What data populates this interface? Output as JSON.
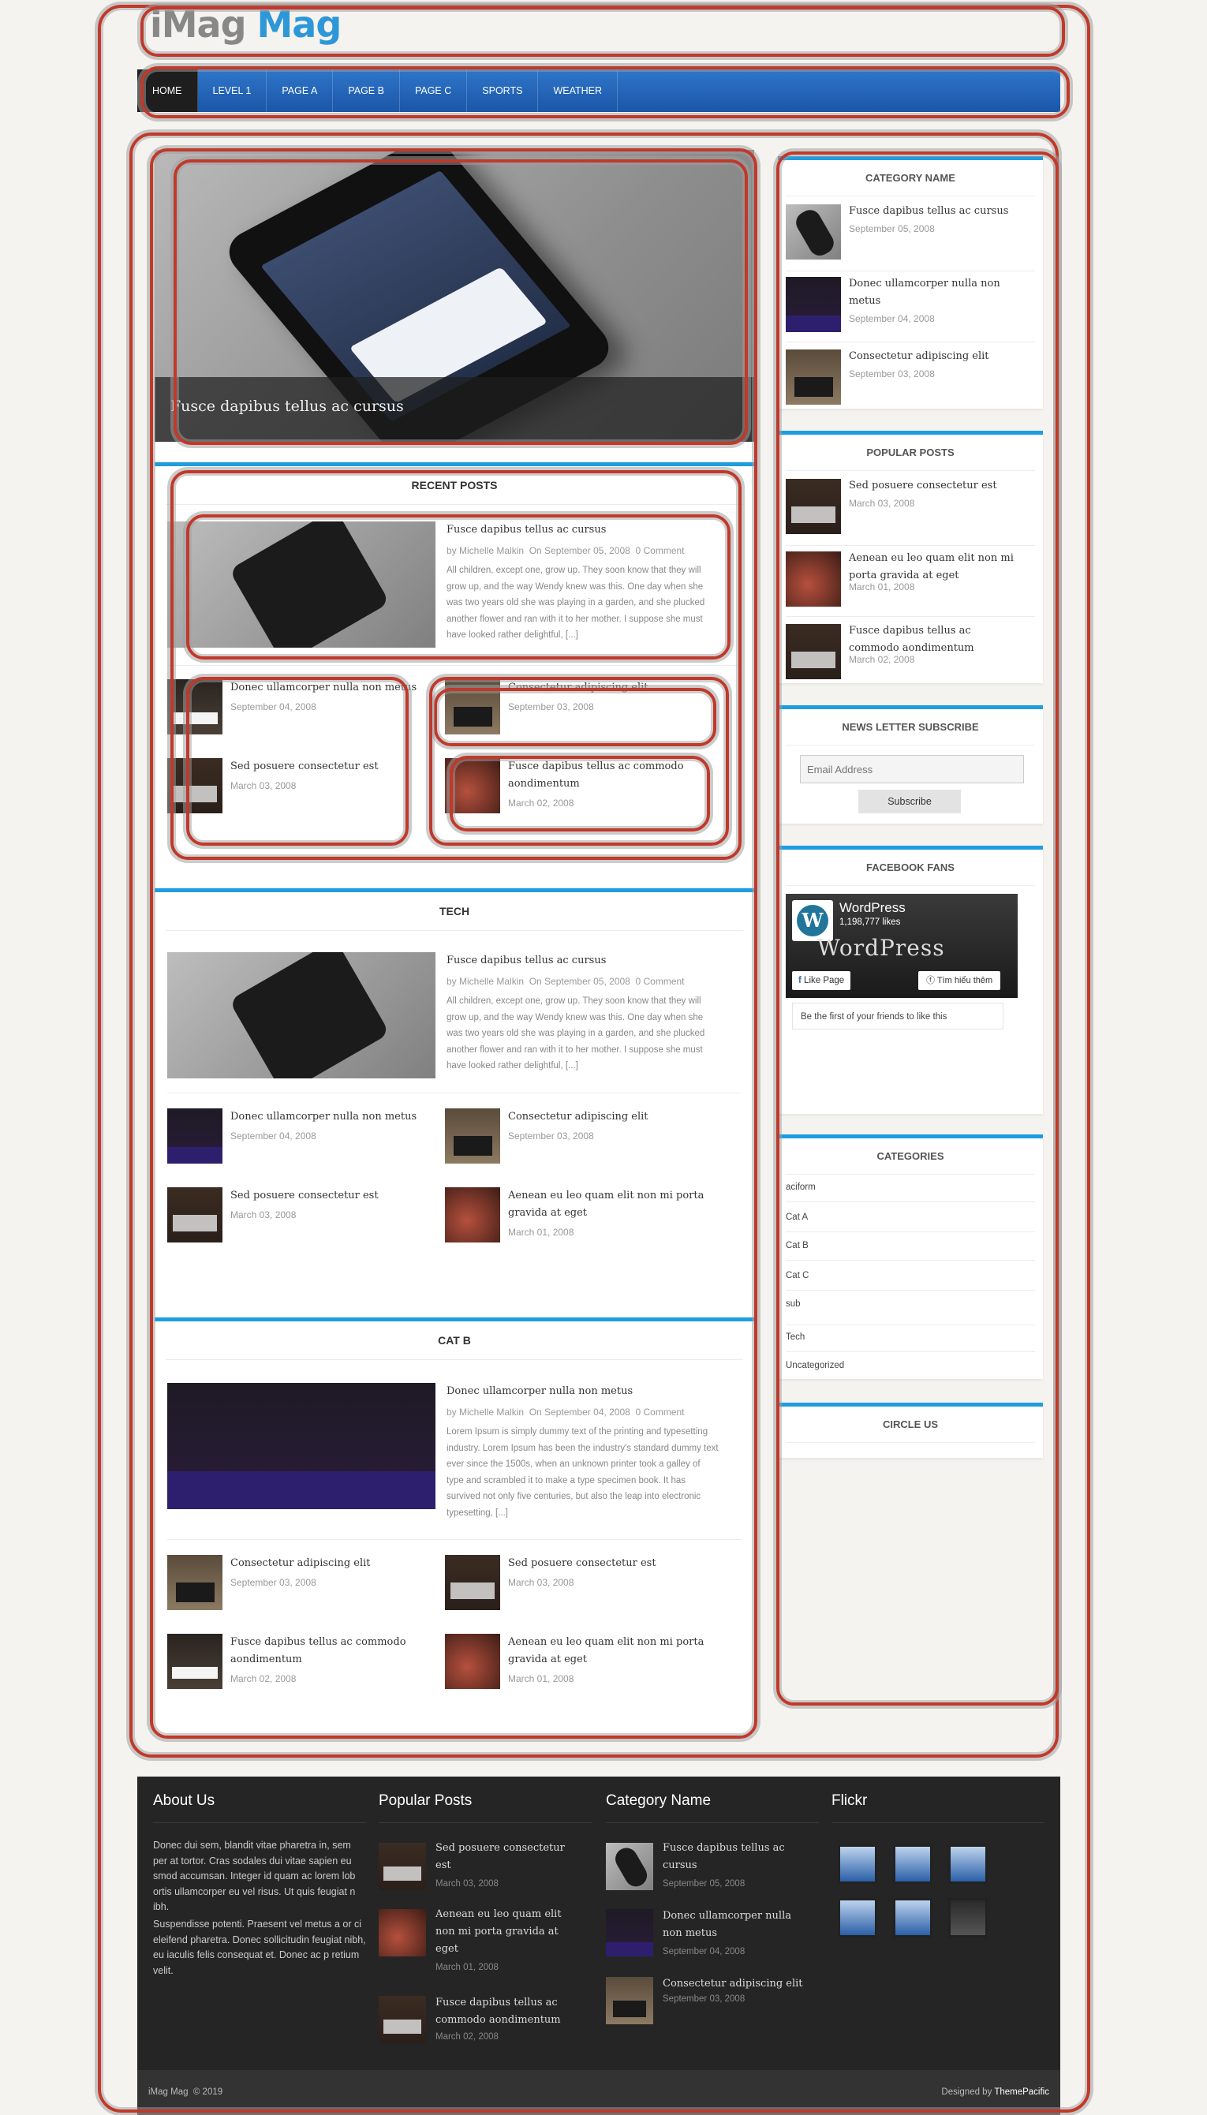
{
  "site": {
    "logo_part1": "iMag",
    "logo_part2": "Mag"
  },
  "nav": [
    "HOME",
    "LEVEL 1",
    "PAGE A",
    "PAGE B",
    "PAGE C",
    "SPORTS",
    "WEATHER"
  ],
  "slider": {
    "caption": "Fusce dapibus tellus ac cursus"
  },
  "recent": {
    "heading": "RECENT POSTS",
    "featured": {
      "title": "Fusce dapibus tellus ac cursus",
      "by": "by Michelle Malkin",
      "on": "On September 05, 2008",
      "comments": "0 Comment",
      "excerpt": "All children, except one, grow up. They soon know that they will grow up, and the way Wendy knew was this. One day when she was two years old she was playing in a garden, and she plucked another flower and ran with it to her mother. I suppose she must have looked rather delightful, [...]"
    },
    "items": [
      {
        "title": "Donec ullamcorper nulla non metus",
        "date": "September 04, 2008"
      },
      {
        "title": "Consectetur adipiscing elit",
        "date": "September 03, 2008"
      },
      {
        "title": "Sed posuere consectetur est",
        "date": "March 03, 2008"
      },
      {
        "title": "Fusce dapibus tellus ac commodo aondimentum",
        "date": "March 02, 2008"
      }
    ]
  },
  "tech": {
    "heading": "TECH",
    "featured": {
      "title": "Fusce dapibus tellus ac cursus",
      "by": "by Michelle Malkin",
      "on": "On September 05, 2008",
      "comments": "0 Comment",
      "excerpt": "All children, except one, grow up. They soon know that they will grow up, and the way Wendy knew was this. One day when she was two years old she was playing in a garden, and she plucked another flower and ran with it to her mother. I suppose she must have looked rather delightful, [...]"
    },
    "items": [
      {
        "title": "Donec ullamcorper nulla non metus",
        "date": "September 04, 2008"
      },
      {
        "title": "Consectetur adipiscing elit",
        "date": "September 03, 2008"
      },
      {
        "title": "Sed posuere consectetur est",
        "date": "March 03, 2008"
      },
      {
        "title": "Aenean eu leo quam elit non mi porta gravida at eget",
        "date": "March 01, 2008"
      }
    ]
  },
  "catb": {
    "heading": "CAT B",
    "featured": {
      "title": "Donec ullamcorper nulla non metus",
      "by": "by Michelle Malkin",
      "on": "On September 04, 2008",
      "comments": "0 Comment",
      "excerpt": "Lorem Ipsum is simply dummy text of the printing and typesetting industry. Lorem Ipsum has been the industry's standard dummy text ever since the 1500s, when an unknown printer took a galley of type and scrambled it to make a type specimen book. It has survived not only five centuries, but also the leap into electronic typesetting, [...]"
    },
    "items": [
      {
        "title": "Consectetur adipiscing elit",
        "date": "September 03, 2008"
      },
      {
        "title": "Sed posuere consectetur est",
        "date": "March 03, 2008"
      },
      {
        "title": "Fusce dapibus tellus ac commodo aondimentum",
        "date": "March 02, 2008"
      },
      {
        "title": "Aenean eu leo quam elit non mi porta gravida at eget",
        "date": "March 01, 2008"
      }
    ]
  },
  "sidebar": {
    "category_name": {
      "heading": "CATEGORY NAME",
      "items": [
        {
          "title": "Fusce dapibus tellus ac cursus",
          "date": "September 05, 2008"
        },
        {
          "title": "Donec ullamcorper nulla non metus",
          "date": "September 04, 2008"
        },
        {
          "title": "Consectetur adipiscing elit",
          "date": "September 03, 2008"
        }
      ]
    },
    "popular": {
      "heading": "POPULAR POSTS",
      "items": [
        {
          "title": "Sed posuere consectetur est",
          "date": "March 03, 2008"
        },
        {
          "title": "Aenean eu leo quam elit non mi porta gravida at eget",
          "date": "March 01, 2008"
        },
        {
          "title": "Fusce dapibus tellus ac commodo aondimentum",
          "date": "March 02, 2008"
        }
      ]
    },
    "newsletter": {
      "heading": "NEWS LETTER SUBSCRIBE",
      "placeholder": "Email Address",
      "button": "Subscribe"
    },
    "facebook": {
      "heading": "FACEBOOK FANS",
      "page": "WordPress",
      "likes": "1,198,777 likes",
      "brand": "WordPress",
      "like_btn": "Like Page",
      "learn_btn": "Tìm hiểu thêm",
      "first": "Be the first of your friends to like this"
    },
    "categories": {
      "heading": "CATEGORIES",
      "items": [
        "aciform",
        "Cat A",
        "Cat B",
        "Cat C",
        "sub",
        "Tech",
        "Uncategorized"
      ]
    },
    "circle": {
      "heading": "CIRCLE US"
    }
  },
  "footer": {
    "about": {
      "heading": "About Us",
      "p1": "Donec dui sem, blandit vitae pharetra in, sem per at tortor. Cras sodales dui vitae sapien eu smod accumsan. Integer id quam ac lorem lob ortis ullamcorper eu vel risus. Ut quis feugiat n ibh.",
      "p2": "Suspendisse potenti. Praesent vel metus a or ci eleifend pharetra. Donec sollicitudin feugiat nibh, eu iaculis felis consequat et. Donec ac p retium velit."
    },
    "popular": {
      "heading": "Popular Posts",
      "items": [
        {
          "title": "Sed posuere consectetur est",
          "date": "March 03, 2008"
        },
        {
          "title": "Aenean eu leo quam elit non mi porta gravida at eget",
          "date": "March 01, 2008"
        },
        {
          "title": "Fusce dapibus tellus ac commodo aondimentum",
          "date": "March 02, 2008"
        }
      ]
    },
    "category": {
      "heading": "Category Name",
      "items": [
        {
          "title": "Fusce dapibus tellus ac cursus",
          "date": "September 05, 2008"
        },
        {
          "title": "Donec ullamcorper nulla non metus",
          "date": "September 04, 2008"
        },
        {
          "title": "Consectetur adipiscing elit",
          "date": "September 03, 2008"
        }
      ]
    },
    "flickr": {
      "heading": "Flickr"
    },
    "copyright": "iMag Mag  © 2019",
    "designed_by": "Designed by",
    "designer": "ThemePacific"
  }
}
